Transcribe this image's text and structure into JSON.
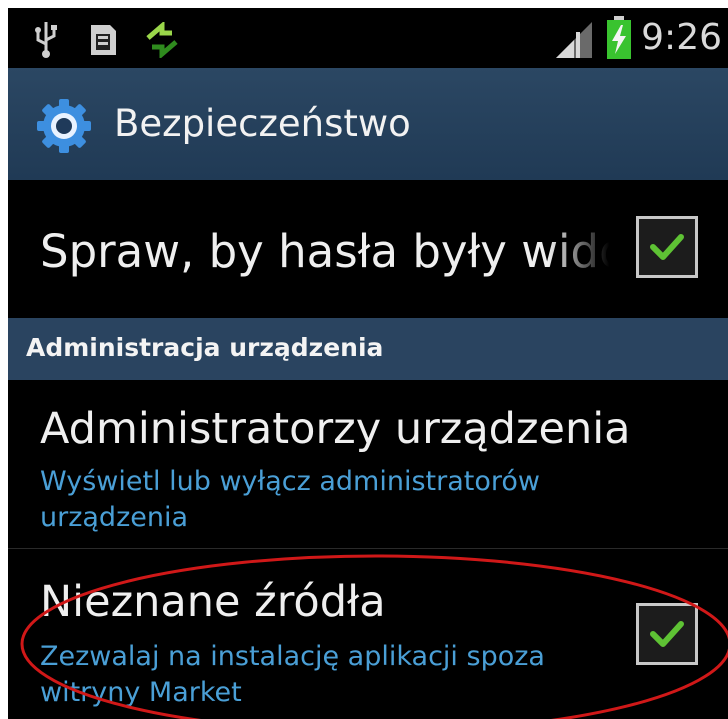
{
  "status_bar": {
    "time": "9:26",
    "icons": [
      "usb-icon",
      "sd-card-icon",
      "sync-icon",
      "signal-icon",
      "battery-charging-icon"
    ]
  },
  "action_bar": {
    "title": "Bezpieczeństwo",
    "icon": "gear-icon"
  },
  "settings": {
    "show_passwords": {
      "title": "Spraw, by hasła były wido",
      "checked": true
    },
    "section": {
      "label": "Administracja urządzenia"
    },
    "device_admins": {
      "title": "Administratorzy urządzenia",
      "subtitle": "Wyświetl lub wyłącz administratorów urządzenia"
    },
    "unknown_sources": {
      "title": "Nieznane źródła",
      "subtitle": "Zezwalaj na instalację aplikacji spoza witryny Market",
      "checked": true
    }
  },
  "colors": {
    "action_bar": "#2b4763",
    "section_header": "#2a4460",
    "subtitle": "#4a9fd6",
    "checkmark": "#5ec234",
    "annotation": "#d01818"
  }
}
